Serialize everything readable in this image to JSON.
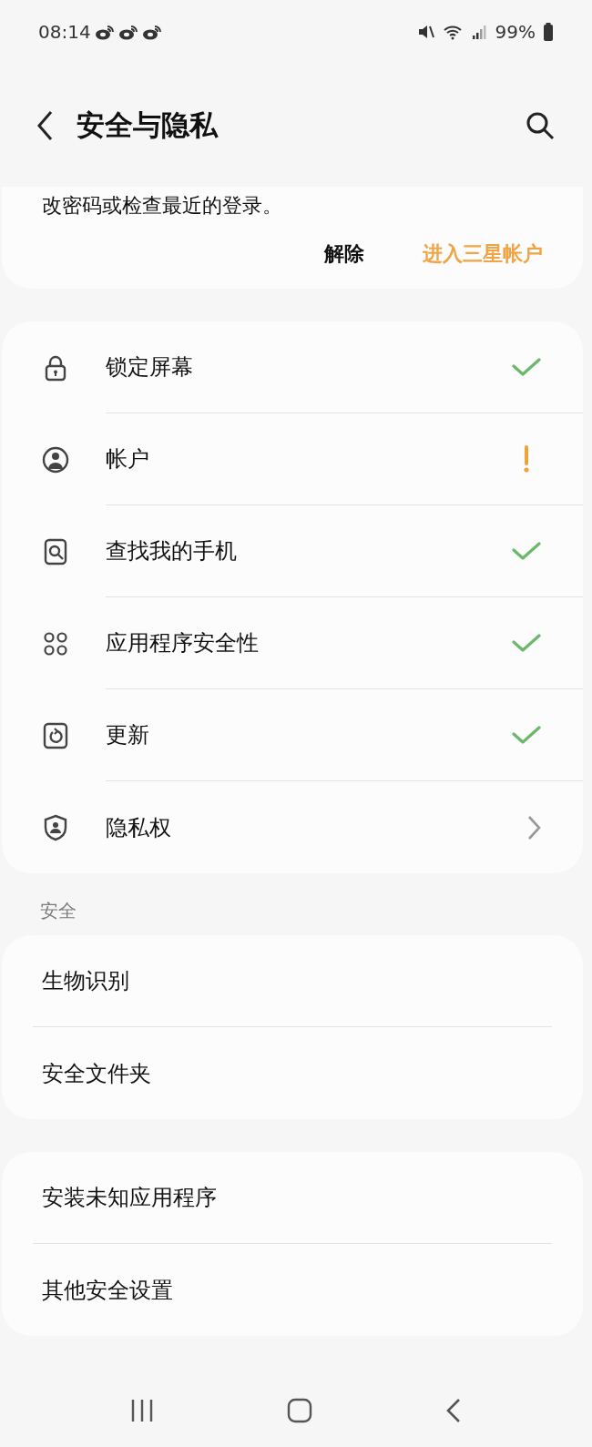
{
  "status_bar": {
    "time": "08:14",
    "battery": "99%"
  },
  "header": {
    "title": "安全与隐私"
  },
  "notice_card": {
    "text": "改密码或检查最近的登录。",
    "buttons": [
      {
        "label": "解除",
        "kind": "dismiss"
      },
      {
        "label": "进入三星帐户",
        "kind": "primary"
      }
    ]
  },
  "status_items": [
    {
      "label": "锁定屏幕",
      "kind": "check"
    },
    {
      "label": "帐户",
      "kind": "warning"
    },
    {
      "label": "查找我的手机",
      "kind": "check"
    },
    {
      "label": "应用程序安全性",
      "kind": "check"
    },
    {
      "label": "更新",
      "kind": "check"
    },
    {
      "label": "隐私权",
      "kind": "chevron"
    }
  ],
  "sections": [
    {
      "title": "安全",
      "items": [
        "生物识别",
        "安全文件夹"
      ]
    },
    {
      "items": [
        "安装未知应用程序",
        "其他安全设置"
      ]
    }
  ]
}
